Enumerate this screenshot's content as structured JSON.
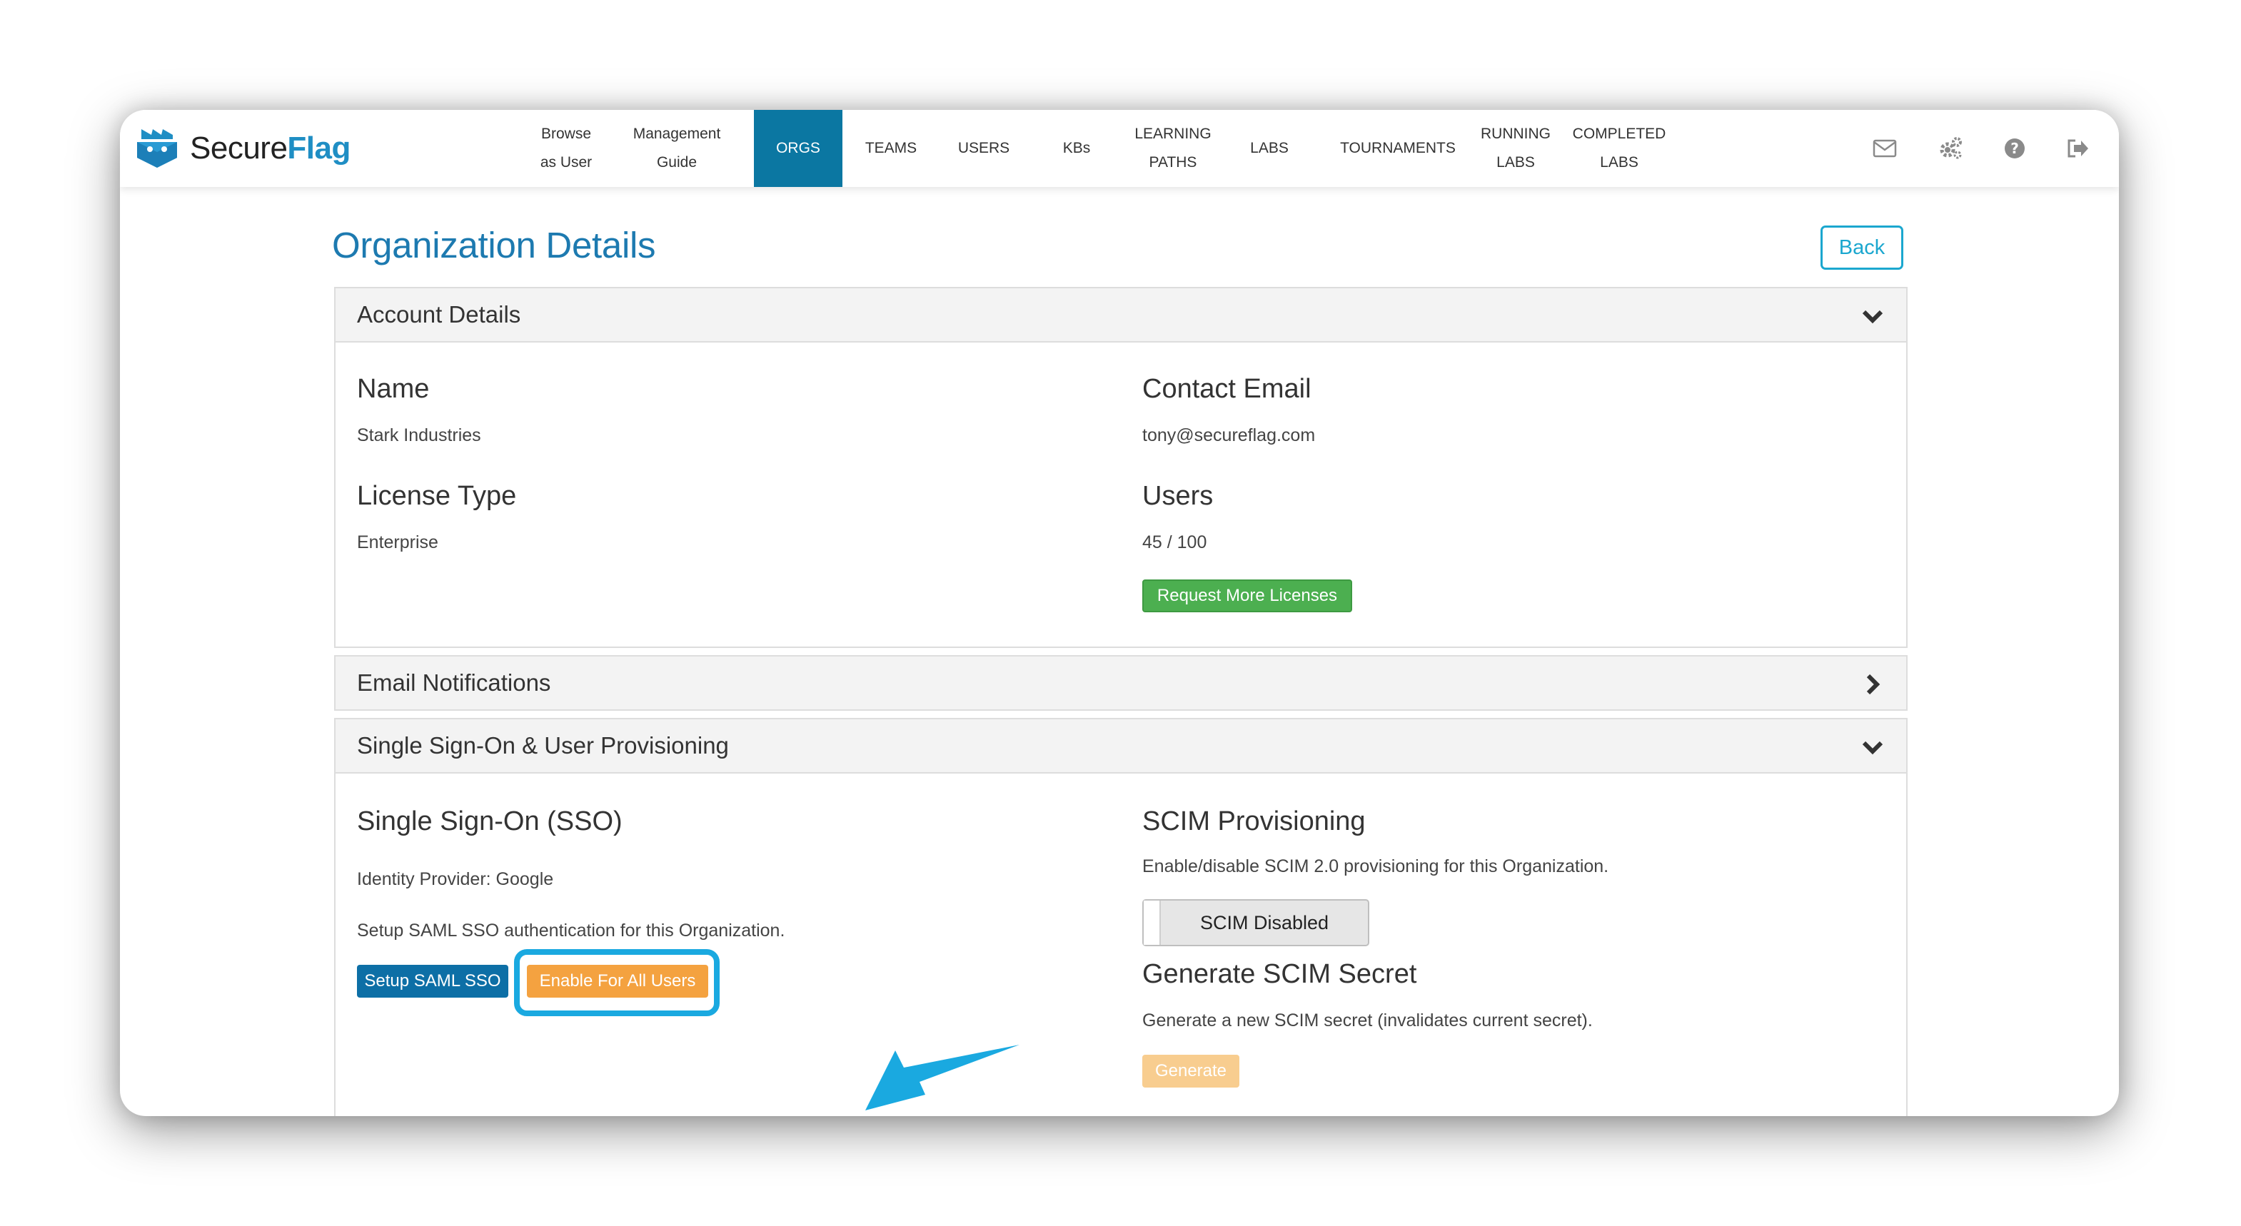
{
  "brand": {
    "name_part1": "Secure",
    "name_part2": "Flag"
  },
  "nav": [
    {
      "line1": "Browse",
      "line2": "as User"
    },
    {
      "line1": "Management",
      "line2": "Guide"
    },
    {
      "line1": "ORGS",
      "line2": ""
    },
    {
      "line1": "TEAMS",
      "line2": ""
    },
    {
      "line1": "USERS",
      "line2": ""
    },
    {
      "line1": "KBs",
      "line2": ""
    },
    {
      "line1": "LEARNING",
      "line2": "PATHS"
    },
    {
      "line1": "LABS",
      "line2": ""
    },
    {
      "line1": "TOURNAMENTS",
      "line2": ""
    },
    {
      "line1": "RUNNING",
      "line2": "LABS"
    },
    {
      "line1": "COMPLETED",
      "line2": "LABS"
    }
  ],
  "active_nav": "ORGS",
  "icons": {
    "mail": "mail-icon",
    "settings": "gears-icon",
    "help": "question-icon",
    "logout": "logout-icon"
  },
  "page": {
    "title": "Organization Details",
    "back": "Back"
  },
  "account": {
    "header": "Account Details",
    "name_label": "Name",
    "name_value": "Stark Industries",
    "email_label": "Contact Email",
    "email_value": "tony@secureflag.com",
    "license_label": "License Type",
    "license_value": "Enterprise",
    "users_label": "Users",
    "users_value": "45 / 100",
    "request_btn": "Request More Licenses"
  },
  "email_notifications": {
    "header": "Email Notifications"
  },
  "sso": {
    "header": "Single Sign-On & User Provisioning",
    "sso_title": "Single Sign-On (SSO)",
    "idp": "Identity Provider: Google",
    "setup_desc": "Setup SAML SSO authentication for this Organization.",
    "setup_btn": "Setup SAML SSO",
    "enable_btn": "Enable For All Users",
    "scim_title": "SCIM Provisioning",
    "scim_desc": "Enable/disable SCIM 2.0 provisioning for this Organization.",
    "scim_toggle": "SCIM Disabled",
    "secret_title": "Generate SCIM Secret",
    "secret_desc": "Generate a new SCIM secret (invalidates current secret).",
    "generate_btn": "Generate"
  },
  "colors": {
    "accent": "#0b77a2",
    "title": "#1d7ab0",
    "green": "#4caf50",
    "orange": "#f4a240",
    "highlight": "#1aa9e0"
  }
}
